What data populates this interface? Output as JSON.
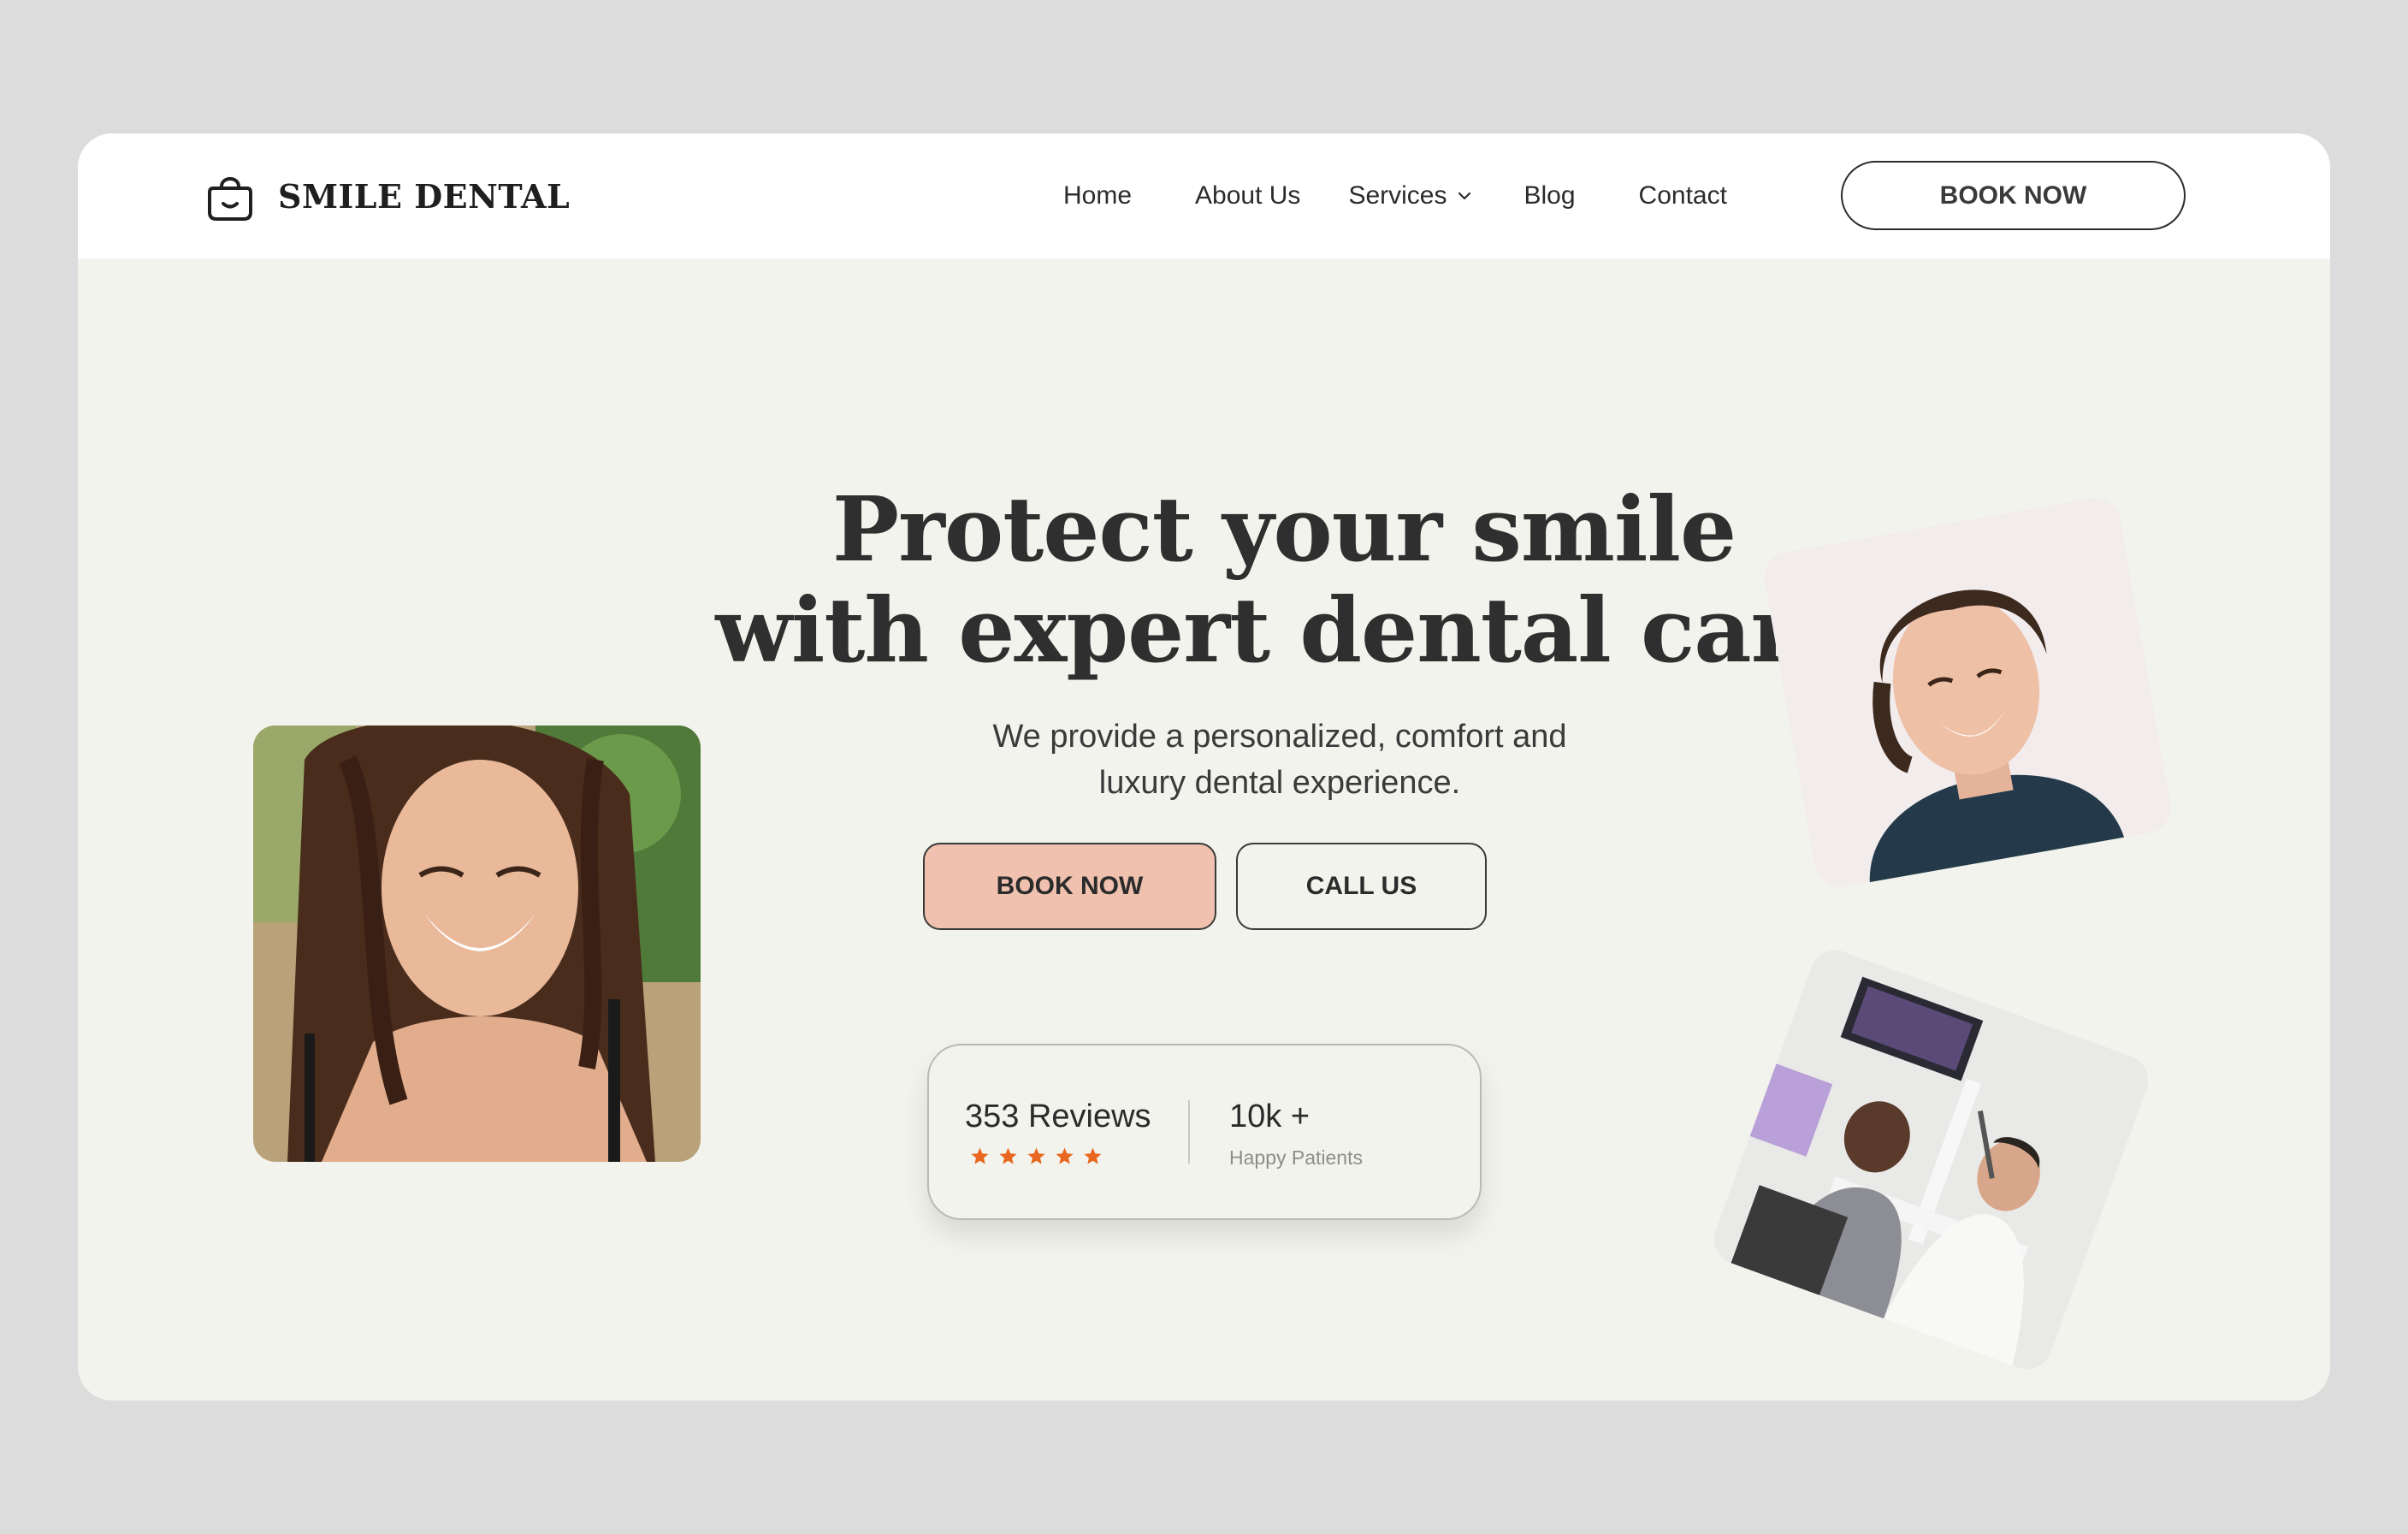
{
  "brand": {
    "name": "SMILE DENTAL",
    "icon": "smiling-bag-icon"
  },
  "nav": {
    "items": [
      {
        "label": "Home"
      },
      {
        "label": "About Us"
      },
      {
        "label": "Services",
        "has_dropdown": true
      },
      {
        "label": "Blog"
      },
      {
        "label": "Contact"
      }
    ],
    "cta_label": "BOOK NOW"
  },
  "hero": {
    "title_line1": "Protect your smile",
    "title_line2": "with expert dental care",
    "subtitle_line1": "We provide a personalized, comfort and",
    "subtitle_line2": "luxury dental experience.",
    "primary_label": "BOOK NOW",
    "secondary_label": "CALL US"
  },
  "stats": {
    "reviews": "353 Reviews",
    "rating_stars": 5,
    "patients": "10k +",
    "patients_label": "Happy Patients"
  },
  "colors": {
    "page_bg": "#dcdcdc",
    "hero_bg": "#f2f3ec",
    "accent": "#f0c1ae",
    "star": "#e8661f",
    "text": "#2b2b2b"
  }
}
